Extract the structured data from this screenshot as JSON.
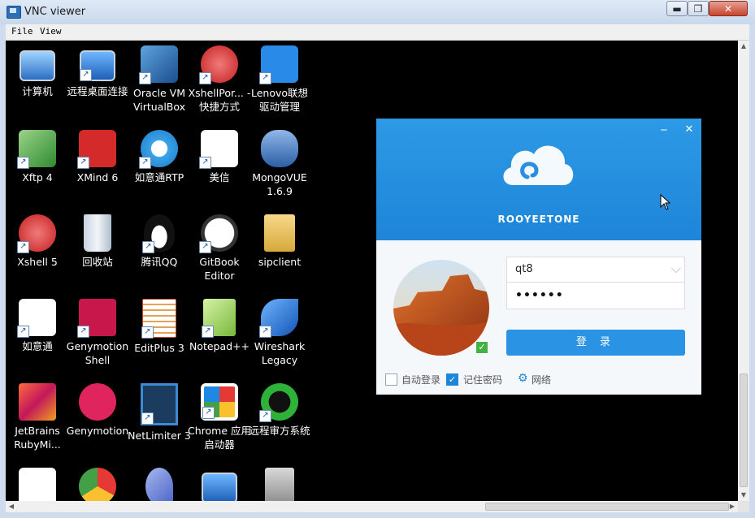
{
  "window": {
    "title": "VNC viewer",
    "minimize": "▬",
    "maximize": "❐",
    "close": "✕"
  },
  "menu": {
    "file": "File",
    "view": "View"
  },
  "desktop_icons": [
    {
      "label": "计算机",
      "icon": "computer-icon"
    },
    {
      "label": "远程桌面连接",
      "icon": "remote-desktop-icon"
    },
    {
      "label": "Oracle VM VirtualBox",
      "icon": "virtualbox-icon"
    },
    {
      "label": "XshellPor... - 快捷方式",
      "icon": "xshell-icon"
    },
    {
      "label": "Lenovo联想驱动管理",
      "icon": "lenovo-driver-icon"
    },
    {
      "label": "Xftp 4",
      "icon": "xftp-icon"
    },
    {
      "label": "XMind 6",
      "icon": "xmind-icon"
    },
    {
      "label": "如意通RTP",
      "icon": "ruyitong-rtp-icon"
    },
    {
      "label": "美信",
      "icon": "meixin-icon"
    },
    {
      "label": "MongoVUE 1.6.9",
      "icon": "mongovue-icon"
    },
    {
      "label": "Xshell 5",
      "icon": "xshell5-icon"
    },
    {
      "label": "回收站",
      "icon": "recycle-bin-icon"
    },
    {
      "label": "腾讯QQ",
      "icon": "qq-icon"
    },
    {
      "label": "GitBook Editor",
      "icon": "gitbook-icon"
    },
    {
      "label": "sipclient",
      "icon": "sipclient-icon"
    },
    {
      "label": "如意通",
      "icon": "ruyitong-icon"
    },
    {
      "label": "Genymotion Shell",
      "icon": "genymotion-shell-icon"
    },
    {
      "label": "EditPlus 3",
      "icon": "editplus-icon"
    },
    {
      "label": "Notepad++",
      "icon": "notepadpp-icon"
    },
    {
      "label": "Wireshark Legacy",
      "icon": "wireshark-icon"
    },
    {
      "label": "JetBrains RubyMi...",
      "icon": "rubymine-icon"
    },
    {
      "label": "Genymotion",
      "icon": "genymotion-icon"
    },
    {
      "label": "NetLimiter 3",
      "icon": "netlimiter-icon"
    },
    {
      "label": "Chrome 应用启动器",
      "icon": "chrome-launcher-icon"
    },
    {
      "label": "远程审方系统",
      "icon": "remote-review-icon"
    },
    {
      "label": "",
      "icon": "ruyitong-icon"
    },
    {
      "label": "",
      "icon": "chrome-icon"
    },
    {
      "label": "",
      "icon": "dolphin-icon"
    },
    {
      "label": "",
      "icon": "remote-desktop-icon"
    },
    {
      "label": "",
      "icon": "installer-icon"
    }
  ],
  "login": {
    "brand": "ROOYEETONE",
    "minimize": "‒",
    "close": "✕",
    "username": "qt8",
    "password": "••••••",
    "login_button": "登 录",
    "auto_login": "自动登录",
    "auto_login_checked": false,
    "remember_password": "记住密码",
    "remember_password_checked": true,
    "network": "网络"
  },
  "colors": {
    "accent": "#2b93e3",
    "header": "#1e85d8",
    "desktop_bg": "#000000"
  }
}
